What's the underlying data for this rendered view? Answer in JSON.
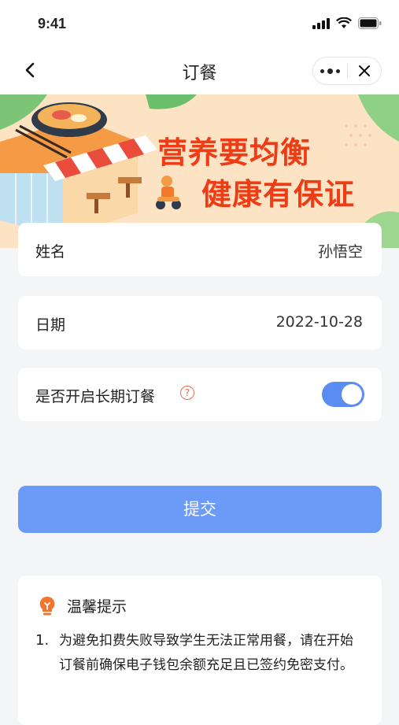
{
  "status_bar": {
    "time": "9:41"
  },
  "nav": {
    "title": "订餐"
  },
  "banner": {
    "slogan_line1": "营养要均衡",
    "slogan_line2": "健康有保证"
  },
  "form": {
    "name_label": "姓名",
    "name_value": "孙悟空",
    "date_label": "日期",
    "date_value": "2022-10-28",
    "long_term_label": "是否开启长期订餐",
    "help_glyph": "?",
    "long_term_enabled": true
  },
  "submit_label": "提交",
  "tips": {
    "title": "温馨提示",
    "items": [
      {
        "num": "1.",
        "text": "为避免扣费失败导致学生无法正常用餐，请在开始订餐前确保电子钱包余额充足且已签约免密支付。"
      }
    ]
  },
  "colors": {
    "accent": "#6b9bf6",
    "toggle_on": "#5b8df0",
    "slogan": "#ee3d16",
    "banner_bg": "#fce3c4",
    "tip_icon": "#f0752e"
  }
}
